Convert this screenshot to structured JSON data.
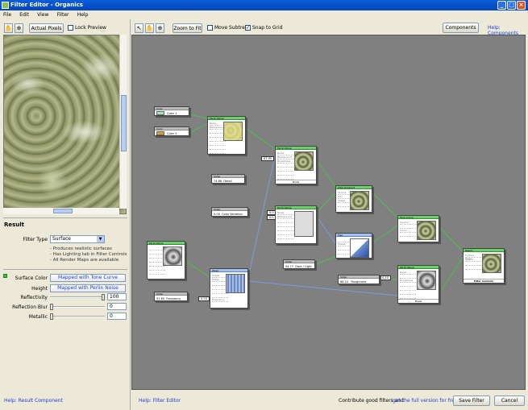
{
  "window": {
    "title": "Filter Editor - Organics"
  },
  "menu": [
    "File",
    "Edit",
    "View",
    "Filter",
    "Help"
  ],
  "left_toolbar": {
    "actual_pixels": "Actual Pixels",
    "lock_preview": "Lock Preview"
  },
  "canvas_toolbar": {
    "zoom_to_fit": "Zoom to Fit",
    "move_subtree": "Move Subtree",
    "snap_to_grid": "Snap to Grid",
    "components": "Components",
    "help_components": "Help: Components"
  },
  "result": {
    "title": "Result",
    "filter_type_label": "Filter Type",
    "filter_type_value": "Surface",
    "descriptions": [
      "- Produces realistic surfaces",
      "- Has Lighting tab in Filter Controls",
      "- All Render Maps are available"
    ],
    "surface_color_label": "Surface Color",
    "surface_color_value": "Mapped with Tone Curve",
    "height_label": "Height",
    "height_value": "Mapped with Perlin Noise",
    "reflectivity_label": "Reflectivity",
    "reflectivity_value": "100",
    "reflectivity_level": 1.0,
    "reflection_blur_label": "Reflection Blur",
    "reflection_blur_value": "0",
    "reflection_blur_level": 0,
    "metallic_label": "Metallic",
    "metallic_value": "0",
    "metallic_level": 0
  },
  "bottom": {
    "help_result": "Help: Result Component",
    "help_filter": "Help: Filter Editor",
    "contribute_text": "Contribute good filters and",
    "full_version_link": "get the full version for free!",
    "save_filter": "Save Filter",
    "cancel": "Cancel"
  },
  "nodes": {
    "color1": {
      "title": "Color",
      "value": "Color 1"
    },
    "color2": {
      "title": "Color",
      "value": "Color 2"
    },
    "perlin1": {
      "title": "Perlin Noise",
      "ports": [
        "Noise",
        "Background",
        "",
        "",
        "",
        "",
        "",
        "",
        "",
        ""
      ]
    },
    "detail": {
      "title": "Slider",
      "value": "74.86",
      "label": "Detail"
    },
    "color_variation": {
      "title": "Slider",
      "value": "0.00",
      "label": "Color Variation"
    },
    "perlin2": {
      "title": "Perlin Noise",
      "ports": [
        "Noise",
        "Background",
        "Roughness",
        "",
        "",
        "",
        "",
        "",
        ""
      ],
      "foot": "Pixels"
    },
    "perlin3": {
      "title": "Perlin Noise",
      "ports": [
        "Noise",
        "Background",
        "",
        "",
        "",
        "",
        "",
        "",
        ""
      ]
    },
    "perlin_left": {
      "title": "Perlin Noise",
      "ports": [
        "",
        "",
        "",
        "",
        "",
        "",
        "",
        "",
        ""
      ]
    },
    "wave": {
      "title": "Wave",
      "ports": [
        "Shape",
        "Phase",
        "",
        "",
        "",
        "",
        "Frequency",
        ""
      ]
    },
    "frequency": {
      "title": "Slider",
      "value": "97.85",
      "label": "Frequency"
    },
    "pixel_gradient": {
      "title": "Pixel Gradient",
      "ports": [
        "Source",
        "Tool",
        "Shape",
        "",
        "",
        ""
      ]
    },
    "map": {
      "title": "Map",
      "ports": [
        "",
        "Shape",
        "",
        "",
        ""
      ]
    },
    "dark_light": {
      "title": "Slider",
      "value": "94.77",
      "label": "Dark / Light"
    },
    "tone_curve": {
      "title": "Tone Curve",
      "ports": [
        "Source",
        "",
        "Curve",
        "",
        ""
      ]
    },
    "perlin4": {
      "title": "Perlin Noise",
      "ports": [
        "Noise",
        "",
        "Roughness",
        "",
        "",
        "",
        "",
        ""
      ],
      "foot": "Pixels"
    },
    "roughness": {
      "title": "Slider",
      "value": "68.24",
      "label": "Roughness"
    },
    "result": {
      "title": "Result",
      "ports": [
        "Surface Color",
        "Height",
        "",
        ""
      ],
      "foot": "Filter Controls"
    }
  },
  "badges": {
    "b1": "67.95",
    "b2": "0.0",
    "b3": "0.0",
    "b4": "0.25",
    "b5": "0.10"
  },
  "colors": {
    "canvas": "#808080",
    "accent": "#1a3dd8",
    "node_green": "#6bcf6b",
    "color1": "#9ee6b5",
    "color2": "#d9a03a"
  }
}
